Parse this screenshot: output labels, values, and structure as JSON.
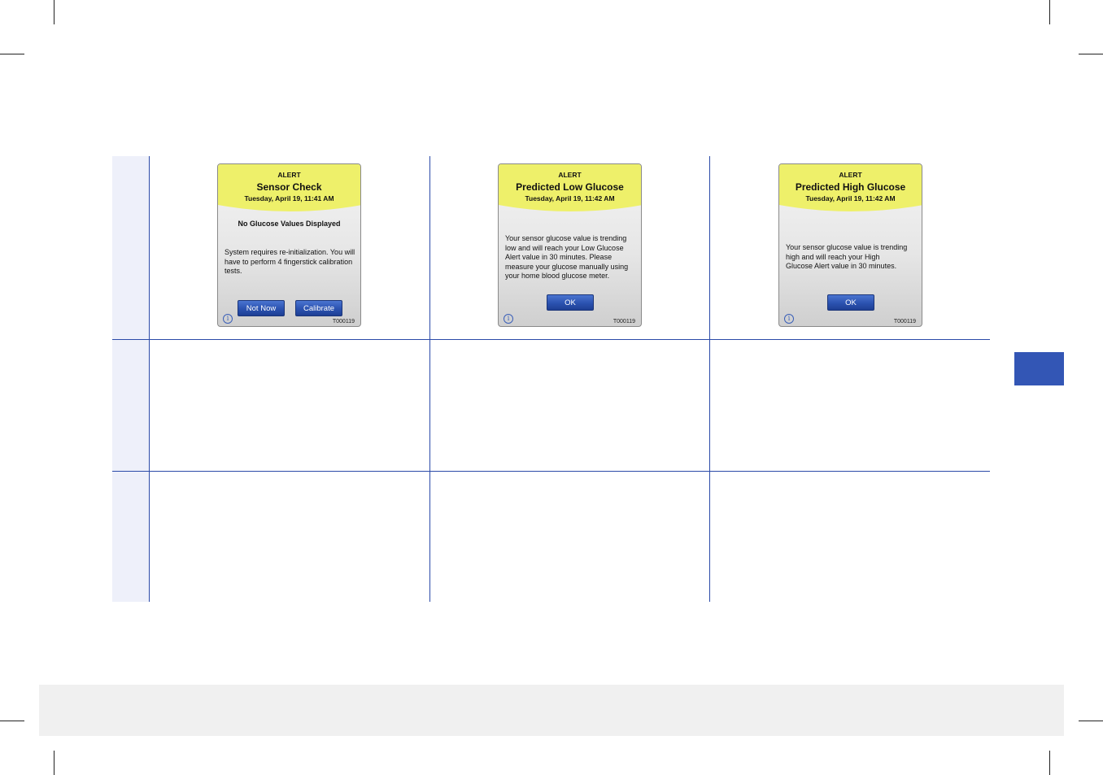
{
  "screens": [
    {
      "label": "ALERT",
      "title": "Sensor Check",
      "date": "Tuesday, April 19, 11:41 AM",
      "subheading": "No Glucose Values Displayed",
      "message": "System requires re-initialization. You will have to perform 4 fingerstick calibration tests.",
      "buttons": [
        "Not Now",
        "Calibrate"
      ],
      "info_icon": "i",
      "code": "T000119"
    },
    {
      "label": "ALERT",
      "title": "Predicted Low Glucose",
      "date": "Tuesday, April 19, 11:42 AM",
      "message": "Your sensor glucose value is trending low and will reach your Low Glucose Alert value in 30 minutes. Please measure your glucose manually using your home blood glucose meter.",
      "buttons": [
        "OK"
      ],
      "info_icon": "i",
      "code": "T000119"
    },
    {
      "label": "ALERT",
      "title": "Predicted High Glucose",
      "date": "Tuesday, April 19, 11:42 AM",
      "message": "Your sensor glucose value is trending high and will reach your High Glucose Alert value in 30 minutes.",
      "buttons": [
        "OK"
      ],
      "info_icon": "i",
      "code": "T000119"
    }
  ],
  "colors": {
    "header_yellow": "#eef06a",
    "table_line": "#2b4aa8",
    "button_blue": "#2b52b0",
    "side_tab": "#3356b5",
    "left_strip": "#eef0fa",
    "footer_bar": "#f0f0f0"
  }
}
